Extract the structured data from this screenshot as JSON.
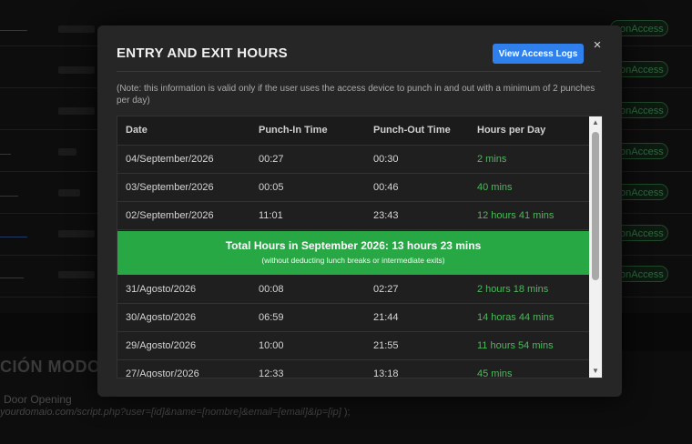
{
  "background": {
    "pill_label": "onAccess",
    "section_heading": "CIÓN MODO A",
    "door_opening_label": "Door Opening",
    "script_url": "yourdomaio.com/script.php?user=[id]&name=[nombre]&email=[email]&ip=[ip]",
    "script_url_tail": " );"
  },
  "modal": {
    "title": "ENTRY AND EXIT HOURS",
    "view_logs_label": "View Access Logs",
    "close_label": "×",
    "note": "(Note: this information is valid only if the user uses the access device to punch in and out with a minimum of 2 punches per day)",
    "columns": [
      "Date",
      "Punch-In Time",
      "Punch-Out Time",
      "Hours per Day"
    ],
    "rows_before_total": [
      {
        "date": "04/September/2026",
        "in": "00:27",
        "out": "00:30",
        "hours": "2 mins"
      },
      {
        "date": "03/September/2026",
        "in": "00:05",
        "out": "00:46",
        "hours": "40 mins"
      },
      {
        "date": "02/September/2026",
        "in": "11:01",
        "out": "23:43",
        "hours": "12 hours 41 mins"
      }
    ],
    "total": {
      "text": "Total Hours in September 2026: 13 hours 23 mins",
      "subtext": "(without deducting lunch breaks or intermediate exits)"
    },
    "rows_after_total": [
      {
        "date": "31/Agosto/2026",
        "in": "00:08",
        "out": "02:27",
        "hours": "2 hours 18 mins"
      },
      {
        "date": "30/Agosto/2026",
        "in": "06:59",
        "out": "21:44",
        "hours": "14 horas 44 mins"
      },
      {
        "date": "29/Agosto/2026",
        "in": "10:00",
        "out": "21:55",
        "hours": "11 hours 54 mins"
      },
      {
        "date": "27/Agostor/2026",
        "in": "12:33",
        "out": "13:18",
        "hours": "45 mins"
      }
    ],
    "scroll_up_icon": "triangle-up",
    "scroll_down_icon": "triangle-down"
  },
  "colors": {
    "accent_button": "#2f80ed",
    "total_banner": "#28a745",
    "hours_text": "#4cb85c"
  }
}
